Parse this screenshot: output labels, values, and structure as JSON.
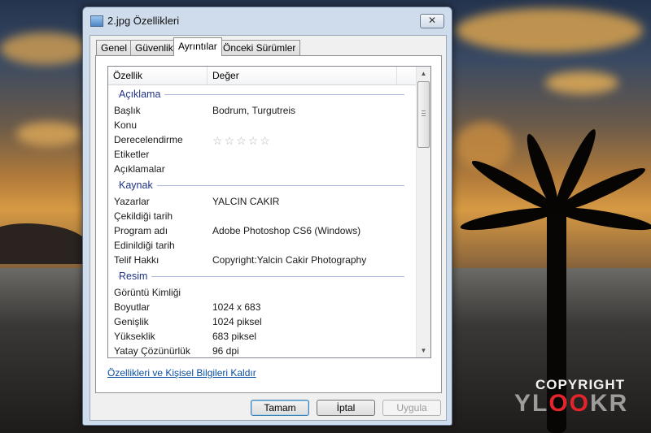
{
  "window": {
    "title": "2.jpg Özellikleri",
    "close_label": "✕"
  },
  "tabs": [
    {
      "label": "Genel"
    },
    {
      "label": "Güvenlik"
    },
    {
      "label": "Ayrıntılar"
    },
    {
      "label": "Önceki Sürümler"
    }
  ],
  "details": {
    "columns": {
      "property": "Özellik",
      "value": "Değer"
    },
    "groups": {
      "description": {
        "title": "Açıklama",
        "rows": [
          {
            "property": "Başlık",
            "value": "Bodrum, Turgutreis"
          },
          {
            "property": "Konu",
            "value": ""
          },
          {
            "property": "Derecelendirme",
            "value": ""
          },
          {
            "property": "Etiketler",
            "value": ""
          },
          {
            "property": "Açıklamalar",
            "value": ""
          }
        ]
      },
      "origin": {
        "title": "Kaynak",
        "rows": [
          {
            "property": "Yazarlar",
            "value": "YALCIN CAKIR"
          },
          {
            "property": "Çekildiği tarih",
            "value": ""
          },
          {
            "property": "Program adı",
            "value": "Adobe Photoshop CS6 (Windows)"
          },
          {
            "property": "Edinildiği tarih",
            "value": ""
          },
          {
            "property": "Telif Hakkı",
            "value": "Copyright:Yalcin Cakir Photography"
          }
        ]
      },
      "image": {
        "title": "Resim",
        "rows": [
          {
            "property": "Görüntü Kimliği",
            "value": ""
          },
          {
            "property": "Boyutlar",
            "value": "1024 x 683"
          },
          {
            "property": "Genişlik",
            "value": "1024 piksel"
          },
          {
            "property": "Yükseklik",
            "value": "683 piksel"
          },
          {
            "property": "Yatay Çözünürlük",
            "value": "96 dpi"
          }
        ]
      }
    },
    "rating_stars": 0,
    "rating_max": 5
  },
  "remove_link": "Özellikleri ve Kişisel Bilgileri Kaldır",
  "buttons": {
    "ok": "Tamam",
    "cancel": "İptal",
    "apply": "Uygula"
  },
  "watermark": {
    "copyright": "COPYRIGHT",
    "logo_left": "YL",
    "logo_mid": "OO",
    "logo_right": "KR"
  },
  "colors": {
    "link": "#0b4ea2",
    "group_title": "#1e3287",
    "watermark_accent": "#e3242b"
  }
}
